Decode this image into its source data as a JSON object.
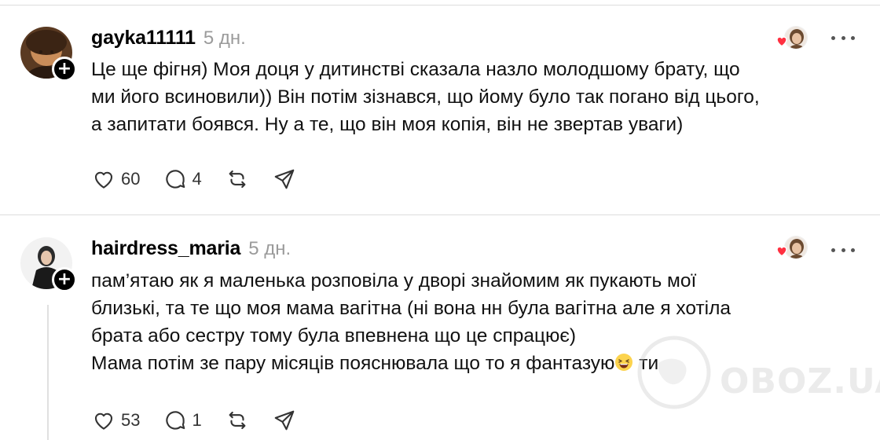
{
  "posts": [
    {
      "username": "gayka11111",
      "time": "5 дн.",
      "lines": [
        "Це ще фігня) Моя доця у дитинстві сказала назло молодшому брату, що",
        "ми його всиновили)) Він потім зізнався, що йому було так погано від цього,",
        "а запитати боявся. Ну а те, що він моя копія, він не звертав уваги)"
      ],
      "likes": "60",
      "replies": "4"
    },
    {
      "username": "hairdress_maria",
      "time": "5 дн.",
      "lines": [
        "пам’ятаю як я маленька розповіла у дворі знайомим як пукають мої",
        "близькі, та те що моя мама вагітна (ні вона нн була вагітна але я хотіла",
        "брата або сестру тому була впевнена що це спрацює)"
      ],
      "last_line_before": "Мама потім зе пару місяців пояснювала що то я фантазую",
      "last_line_after": " ти",
      "likes": "53",
      "replies": "1"
    }
  ],
  "watermark": "OBOZ.UA",
  "icons": {
    "heart": "heart-icon",
    "reply": "comment-icon",
    "repost": "repost-icon",
    "share": "share-icon",
    "more": "more-icon",
    "follow": "plus-icon"
  },
  "colors": {
    "liked_heart": "#ff3040",
    "muted": "#9b9b9b",
    "divider": "#dcdcdc"
  }
}
